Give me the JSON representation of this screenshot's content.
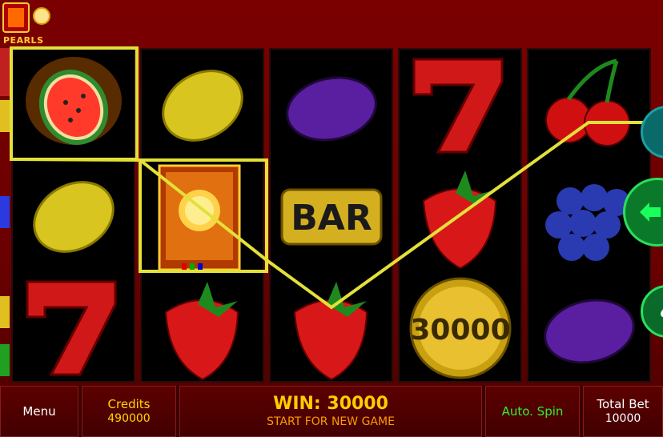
{
  "logo": {
    "text": "PEARLS"
  },
  "reels": [
    [
      "watermelon",
      "lemon",
      "seven"
    ],
    [
      "lemon",
      "book",
      "strawberry"
    ],
    [
      "plum",
      "bar",
      "strawberry"
    ],
    [
      "seven",
      "strawberry",
      "coin-30000"
    ],
    [
      "cherry",
      "grapes",
      "plum"
    ]
  ],
  "symbols": {
    "bar_label": "BAR",
    "coin_label": "30000"
  },
  "bottom_bar": {
    "menu_label": "Menu",
    "credits_label": "Credits",
    "credits_value": "490000",
    "win_text": "WIN: 30000",
    "start_text": "START FOR NEW GAME",
    "autospin_label": "Auto. Spin",
    "totalbet_label": "Total Bet",
    "totalbet_value": "10000"
  },
  "colors": {
    "payline": "#e3e03a",
    "accent": "#ffd700",
    "autospin": "#33ee33",
    "background": "#6a0000"
  },
  "side_buttons": [
    "info-icon",
    "spin-arrow-icon",
    "gamble-spade-icon"
  ]
}
